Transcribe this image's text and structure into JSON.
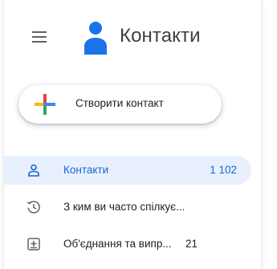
{
  "header": {
    "menu_icon": "hamburger-menu-icon",
    "logo_icon": "contacts-person-logo",
    "title": "Контакти"
  },
  "create_button": {
    "icon": "colorful-plus-icon",
    "label": "Створити контакт"
  },
  "nav": {
    "items": [
      {
        "icon": "person-outline-icon",
        "label": "Контакти",
        "count": "1 102",
        "active": true
      },
      {
        "icon": "history-clock-icon",
        "label": "З ким ви часто спілкує...",
        "count": "",
        "active": false
      },
      {
        "icon": "merge-fix-icon",
        "label": "Об'єднання та випр...",
        "count": "21",
        "active": false
      }
    ]
  },
  "colors": {
    "accent": "#1967d2",
    "active_bg": "#e8f0fe",
    "logo_blue": "#1a73e8",
    "text": "#202124",
    "icon_gray": "#5f6368"
  }
}
